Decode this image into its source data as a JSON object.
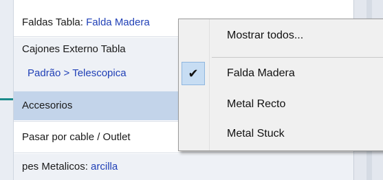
{
  "properties": {
    "faldas": {
      "label": "Faldas Tabla:",
      "value": "Falda Madera"
    },
    "cajones": {
      "label": "Cajones Externo Tabla",
      "value": "Padrão > Telescopica"
    },
    "accesorios": {
      "label": "Accesorios"
    },
    "pasar": {
      "label": "Pasar por cable / Outlet"
    },
    "pies": {
      "label": "pes Metalicos:",
      "value": "arcilla"
    }
  },
  "context_menu": {
    "items": [
      {
        "label": "Mostrar todos...",
        "checked": false
      },
      {
        "label": "Falda Madera",
        "checked": true
      },
      {
        "label": "Metal Recto",
        "checked": false
      },
      {
        "label": "Metal Stuck",
        "checked": false
      }
    ],
    "check_glyph": "✔"
  }
}
